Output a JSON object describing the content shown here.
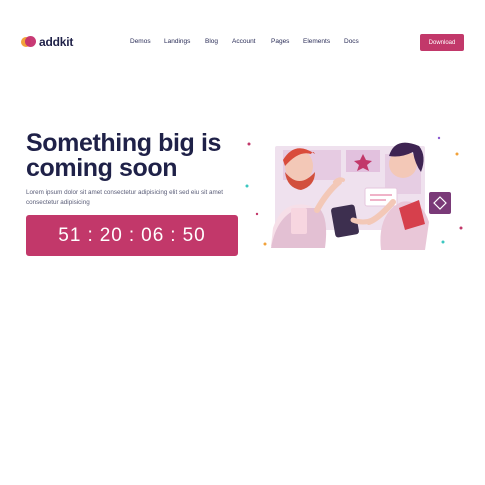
{
  "brand": {
    "name": "addkit"
  },
  "nav": {
    "items": [
      "Demos",
      "Landings",
      "Blog",
      "Account",
      "Pages",
      "Elements",
      "Docs"
    ],
    "download_label": "Download"
  },
  "hero": {
    "title_line1": "Something big is",
    "title_line2": "coming soon",
    "description": "Lorem ipsum dolor sit amet consectetur adipisicing elit sed eiu sit amet consectetur adipisicing",
    "countdown": {
      "days": "51",
      "hours": "20",
      "minutes": "06",
      "seconds": "50",
      "separator": ":"
    }
  },
  "colors": {
    "accent": "#c2386a",
    "heading": "#1f2148",
    "logo_orange": "#f2a23a"
  },
  "illustration": {
    "name": "two-people-collaborating-illustration"
  }
}
